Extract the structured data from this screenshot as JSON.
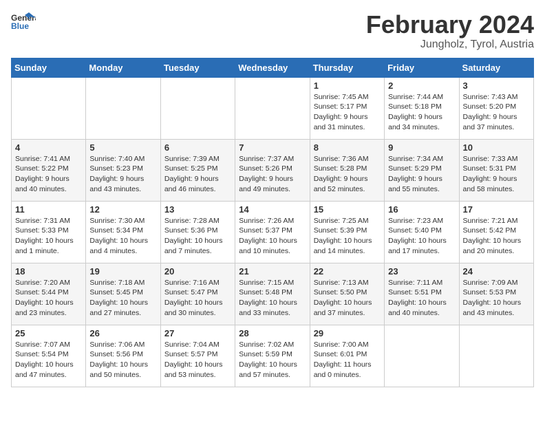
{
  "header": {
    "logo_general": "General",
    "logo_blue": "Blue",
    "main_title": "February 2024",
    "sub_title": "Jungholz, Tyrol, Austria"
  },
  "days_of_week": [
    "Sunday",
    "Monday",
    "Tuesday",
    "Wednesday",
    "Thursday",
    "Friday",
    "Saturday"
  ],
  "weeks": [
    [
      {
        "day": "",
        "info": ""
      },
      {
        "day": "",
        "info": ""
      },
      {
        "day": "",
        "info": ""
      },
      {
        "day": "",
        "info": ""
      },
      {
        "day": "1",
        "info": "Sunrise: 7:45 AM\nSunset: 5:17 PM\nDaylight: 9 hours\nand 31 minutes."
      },
      {
        "day": "2",
        "info": "Sunrise: 7:44 AM\nSunset: 5:18 PM\nDaylight: 9 hours\nand 34 minutes."
      },
      {
        "day": "3",
        "info": "Sunrise: 7:43 AM\nSunset: 5:20 PM\nDaylight: 9 hours\nand 37 minutes."
      }
    ],
    [
      {
        "day": "4",
        "info": "Sunrise: 7:41 AM\nSunset: 5:22 PM\nDaylight: 9 hours\nand 40 minutes."
      },
      {
        "day": "5",
        "info": "Sunrise: 7:40 AM\nSunset: 5:23 PM\nDaylight: 9 hours\nand 43 minutes."
      },
      {
        "day": "6",
        "info": "Sunrise: 7:39 AM\nSunset: 5:25 PM\nDaylight: 9 hours\nand 46 minutes."
      },
      {
        "day": "7",
        "info": "Sunrise: 7:37 AM\nSunset: 5:26 PM\nDaylight: 9 hours\nand 49 minutes."
      },
      {
        "day": "8",
        "info": "Sunrise: 7:36 AM\nSunset: 5:28 PM\nDaylight: 9 hours\nand 52 minutes."
      },
      {
        "day": "9",
        "info": "Sunrise: 7:34 AM\nSunset: 5:29 PM\nDaylight: 9 hours\nand 55 minutes."
      },
      {
        "day": "10",
        "info": "Sunrise: 7:33 AM\nSunset: 5:31 PM\nDaylight: 9 hours\nand 58 minutes."
      }
    ],
    [
      {
        "day": "11",
        "info": "Sunrise: 7:31 AM\nSunset: 5:33 PM\nDaylight: 10 hours\nand 1 minute."
      },
      {
        "day": "12",
        "info": "Sunrise: 7:30 AM\nSunset: 5:34 PM\nDaylight: 10 hours\nand 4 minutes."
      },
      {
        "day": "13",
        "info": "Sunrise: 7:28 AM\nSunset: 5:36 PM\nDaylight: 10 hours\nand 7 minutes."
      },
      {
        "day": "14",
        "info": "Sunrise: 7:26 AM\nSunset: 5:37 PM\nDaylight: 10 hours\nand 10 minutes."
      },
      {
        "day": "15",
        "info": "Sunrise: 7:25 AM\nSunset: 5:39 PM\nDaylight: 10 hours\nand 14 minutes."
      },
      {
        "day": "16",
        "info": "Sunrise: 7:23 AM\nSunset: 5:40 PM\nDaylight: 10 hours\nand 17 minutes."
      },
      {
        "day": "17",
        "info": "Sunrise: 7:21 AM\nSunset: 5:42 PM\nDaylight: 10 hours\nand 20 minutes."
      }
    ],
    [
      {
        "day": "18",
        "info": "Sunrise: 7:20 AM\nSunset: 5:44 PM\nDaylight: 10 hours\nand 23 minutes."
      },
      {
        "day": "19",
        "info": "Sunrise: 7:18 AM\nSunset: 5:45 PM\nDaylight: 10 hours\nand 27 minutes."
      },
      {
        "day": "20",
        "info": "Sunrise: 7:16 AM\nSunset: 5:47 PM\nDaylight: 10 hours\nand 30 minutes."
      },
      {
        "day": "21",
        "info": "Sunrise: 7:15 AM\nSunset: 5:48 PM\nDaylight: 10 hours\nand 33 minutes."
      },
      {
        "day": "22",
        "info": "Sunrise: 7:13 AM\nSunset: 5:50 PM\nDaylight: 10 hours\nand 37 minutes."
      },
      {
        "day": "23",
        "info": "Sunrise: 7:11 AM\nSunset: 5:51 PM\nDaylight: 10 hours\nand 40 minutes."
      },
      {
        "day": "24",
        "info": "Sunrise: 7:09 AM\nSunset: 5:53 PM\nDaylight: 10 hours\nand 43 minutes."
      }
    ],
    [
      {
        "day": "25",
        "info": "Sunrise: 7:07 AM\nSunset: 5:54 PM\nDaylight: 10 hours\nand 47 minutes."
      },
      {
        "day": "26",
        "info": "Sunrise: 7:06 AM\nSunset: 5:56 PM\nDaylight: 10 hours\nand 50 minutes."
      },
      {
        "day": "27",
        "info": "Sunrise: 7:04 AM\nSunset: 5:57 PM\nDaylight: 10 hours\nand 53 minutes."
      },
      {
        "day": "28",
        "info": "Sunrise: 7:02 AM\nSunset: 5:59 PM\nDaylight: 10 hours\nand 57 minutes."
      },
      {
        "day": "29",
        "info": "Sunrise: 7:00 AM\nSunset: 6:01 PM\nDaylight: 11 hours\nand 0 minutes."
      },
      {
        "day": "",
        "info": ""
      },
      {
        "day": "",
        "info": ""
      }
    ]
  ]
}
